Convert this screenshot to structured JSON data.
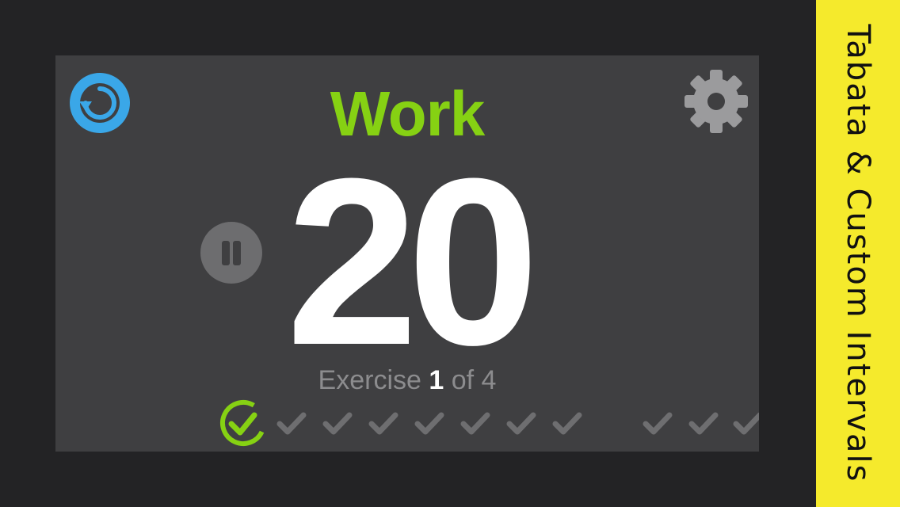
{
  "app": {
    "phase_label": "Work",
    "countdown": "20",
    "exercise": {
      "prefix": "Exercise",
      "current": "1",
      "separator": "of",
      "total": "4"
    },
    "rounds": {
      "completed_active_index": 0,
      "visible_rounds": 11
    }
  },
  "banner": {
    "text": "Tabata & Custom Intervals"
  },
  "icons": {
    "reset": "reset-icon",
    "settings": "gear-icon",
    "pause": "pause-icon",
    "check": "check-icon"
  },
  "colors": {
    "work_green": "#86d113",
    "reset_blue": "#3aa7e8",
    "gear_gray": "#9b9b9d",
    "check_gray": "#6e6e70",
    "banner_yellow": "#f5ea2c",
    "screen_bg": "#3f3f41"
  }
}
